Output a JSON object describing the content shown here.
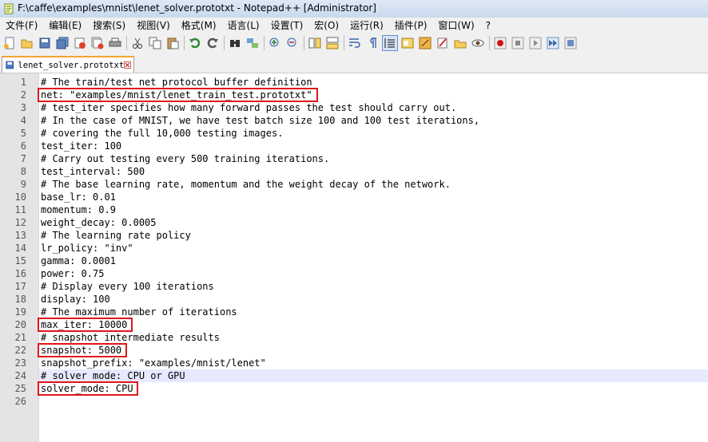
{
  "window": {
    "title": "F:\\caffe\\examples\\mnist\\lenet_solver.prototxt - Notepad++ [Administrator]"
  },
  "menu": [
    "文件(F)",
    "编辑(E)",
    "搜索(S)",
    "视图(V)",
    "格式(M)",
    "语言(L)",
    "设置(T)",
    "宏(O)",
    "运行(R)",
    "插件(P)",
    "窗口(W)",
    "?"
  ],
  "toolbar": {
    "icons": [
      "new-file-icon",
      "open-file-icon",
      "save-icon",
      "save-all-icon",
      "close-icon",
      "close-all-icon",
      "print-icon",
      "cut-icon",
      "copy-icon",
      "paste-icon",
      "undo-icon",
      "redo-icon",
      "find-icon",
      "replace-icon",
      "zoom-in-icon",
      "zoom-out-icon",
      "sync-vertical-icon",
      "sync-horizontal-icon",
      "word-wrap-icon",
      "show-all-chars-icon",
      "indent-guide-icon",
      "document-map-icon",
      "function-list-icon",
      "folder-icon",
      "monitor-icon",
      "record-macro-icon",
      "stop-record-icon",
      "play-macro-icon",
      "run-macro-multiple-icon",
      "save-macro-icon"
    ],
    "active_icon": "indent-guide-icon"
  },
  "tab": {
    "label": "lenet_solver.prototxt"
  },
  "editor": {
    "current_line": 24,
    "lines": [
      "# The train/test net protocol buffer definition",
      "net: \"examples/mnist/lenet_train_test.prototxt\"",
      "# test_iter specifies how many forward passes the test should carry out.",
      "# In the case of MNIST, we have test batch size 100 and 100 test iterations,",
      "# covering the full 10,000 testing images.",
      "test_iter: 100",
      "# Carry out testing every 500 training iterations.",
      "test_interval: 500",
      "# The base learning rate, momentum and the weight decay of the network.",
      "base_lr: 0.01",
      "momentum: 0.9",
      "weight_decay: 0.0005",
      "# The learning rate policy",
      "lr_policy: \"inv\"",
      "gamma: 0.0001",
      "power: 0.75",
      "# Display every 100 iterations",
      "display: 100",
      "# The maximum number of iterations",
      "max_iter: 10000",
      "# snapshot intermediate results",
      "snapshot: 5000",
      "snapshot_prefix: \"examples/mnist/lenet\"",
      "# solver mode: CPU or GPU",
      "solver_mode: CPU",
      ""
    ],
    "highlighted_lines": [
      2,
      20,
      22,
      25
    ]
  },
  "colors": {
    "highlight_box": "#e0161b",
    "current_line_bg": "#e8e8ff",
    "tab_accent": "#f6a431",
    "gutter_bg": "#e4e4e4"
  }
}
